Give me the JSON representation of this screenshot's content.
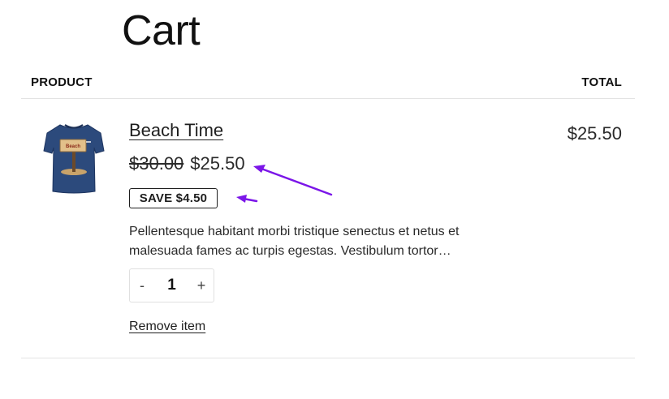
{
  "page": {
    "title": "Cart"
  },
  "table": {
    "col_product": "PRODUCT",
    "col_total": "TOTAL"
  },
  "item": {
    "name": "Beach Time",
    "thumbnail_icon": "tshirt-beach-image",
    "price_original": "$30.00",
    "price_sale": "$25.50",
    "save_badge": "SAVE $4.50",
    "description": "Pellentesque habitant morbi tristique senectus et netus et malesuada fames ac turpis egestas. Vestibulum tortor…",
    "quantity": "1",
    "qty_minus": "-",
    "qty_plus": "+",
    "remove_label": "Remove item",
    "line_total": "$25.50"
  },
  "colors": {
    "annotation_arrow": "#7b16e8",
    "shirt": "#2c4a7c",
    "divider": "#e3e3e3"
  }
}
